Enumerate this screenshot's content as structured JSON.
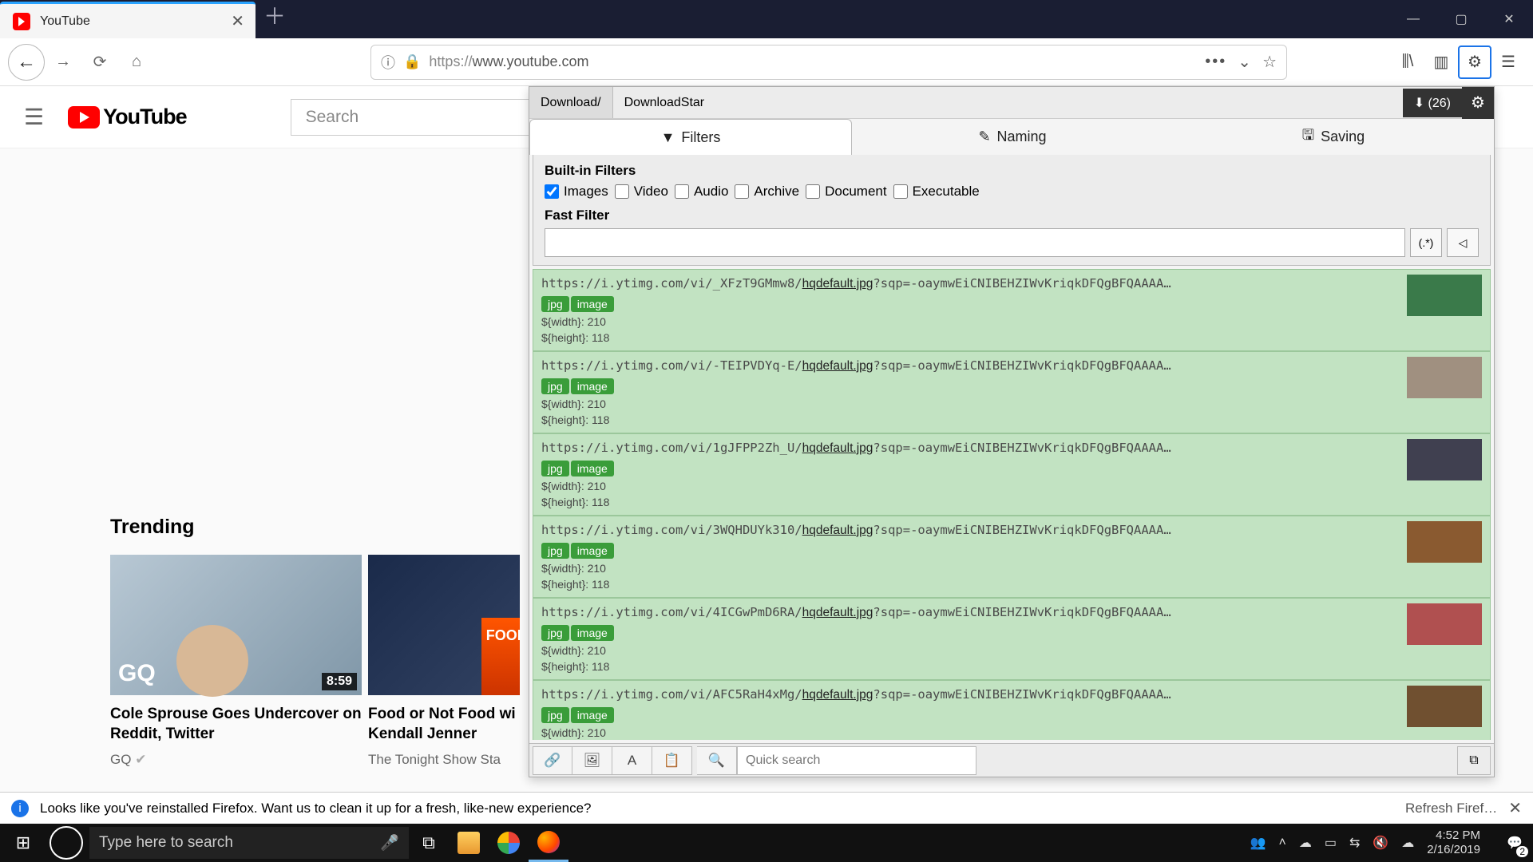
{
  "browser": {
    "tab_title": "YouTube",
    "url_protocol": "https://",
    "url_host": "www.youtube.com"
  },
  "youtube": {
    "logo_text": "YouTube",
    "search_placeholder": "Search",
    "trending_label": "Trending",
    "videos": [
      {
        "title": "Cole Sprouse Goes Undercover on Reddit, Twitter",
        "channel": "GQ",
        "duration": "8:59",
        "gq": "GQ"
      },
      {
        "title": "Food or Not Food wi Kendall Jenner",
        "channel": "The Tonight Show Sta",
        "overlay": "FOOD OR N"
      }
    ]
  },
  "ext": {
    "crumb1": "Download/",
    "crumb2": "DownloadStar",
    "dl_count": "(26)",
    "tabs": {
      "filters": "Filters",
      "naming": "Naming",
      "saving": "Saving"
    },
    "builtin_label": "Built-in Filters",
    "filters": {
      "images": "Images",
      "video": "Video",
      "audio": "Audio",
      "archive": "Archive",
      "document": "Document",
      "executable": "Executable"
    },
    "fastfilter_label": "Fast Filter",
    "regex_btn": "(.*)",
    "width_label": "${width}: 210",
    "height_label": "${height}: 118",
    "tag_jpg": "jpg",
    "tag_image": "image",
    "quick_search": "Quick search",
    "items": [
      {
        "prefix": "https://i.ytimg.com/vi/_XFzT9GMmw8/",
        "file": "hqdefault.jpg",
        "suffix": "?sqp=-oaymwEiCNIBEHZIWvKriqkDFQgBFQAAAA…",
        "thumb": "#3a7a4a"
      },
      {
        "prefix": "https://i.ytimg.com/vi/-TEIPVDYq-E/",
        "file": "hqdefault.jpg",
        "suffix": "?sqp=-oaymwEiCNIBEHZIWvKriqkDFQgBFQAAAA…",
        "thumb": "#a09080"
      },
      {
        "prefix": "https://i.ytimg.com/vi/1gJFPP2Zh_U/",
        "file": "hqdefault.jpg",
        "suffix": "?sqp=-oaymwEiCNIBEHZIWvKriqkDFQgBFQAAAA…",
        "thumb": "#404050"
      },
      {
        "prefix": "https://i.ytimg.com/vi/3WQHDUYk310/",
        "file": "hqdefault.jpg",
        "suffix": "?sqp=-oaymwEiCNIBEHZIWvKriqkDFQgBFQAAAA…",
        "thumb": "#8a5a30"
      },
      {
        "prefix": "https://i.ytimg.com/vi/4ICGwPmD6RA/",
        "file": "hqdefault.jpg",
        "suffix": "?sqp=-oaymwEiCNIBEHZIWvKriqkDFQgBFQAAAA…",
        "thumb": "#b05050"
      },
      {
        "prefix": "https://i.ytimg.com/vi/AFC5RaH4xMg/",
        "file": "hqdefault.jpg",
        "suffix": "?sqp=-oaymwEiCNIBEHZIWvKriqkDFQgBFQAAAA…",
        "thumb": "#705030"
      }
    ]
  },
  "infobar": {
    "msg": "Looks like you've reinstalled Firefox. Want us to clean it up for a fresh, like-new experience?",
    "refresh": "Refresh Firef…"
  },
  "taskbar": {
    "search_placeholder": "Type here to search",
    "time": "4:52 PM",
    "date": "2/16/2019",
    "notif_count": "2"
  }
}
